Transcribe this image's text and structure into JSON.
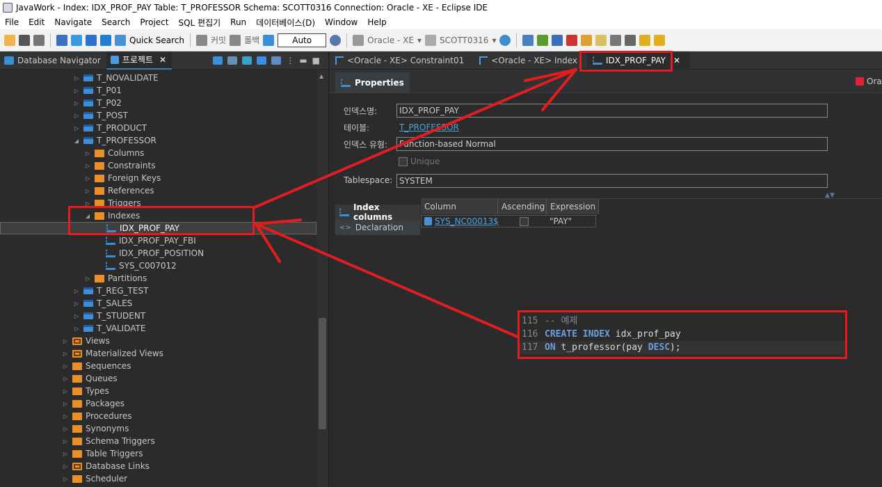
{
  "window": {
    "title": "JavaWork - Index: IDX_PROF_PAY Table: T_PROFESSOR Schema: SCOTT0316 Connection: Oracle - XE  - Eclipse IDE"
  },
  "menu": [
    "File",
    "Edit",
    "Navigate",
    "Search",
    "Project",
    "SQL 편집기",
    "Run",
    "데이터베이스(D)",
    "Window",
    "Help"
  ],
  "toolbar": {
    "quick_search": "Quick Search",
    "commit": "커밋",
    "rollback": "롤백",
    "mode": "Auto",
    "connection": "Oracle - XE",
    "schema": "SCOTT0316"
  },
  "left_panel": {
    "tab_db_navigator": "Database Navigator",
    "tab_project": "프로젝트",
    "tree": [
      {
        "label": "T_NOVALIDATE",
        "icon": "table-icon",
        "expand": "collapsed",
        "indent": 1
      },
      {
        "label": "T_P01",
        "icon": "table-icon",
        "expand": "collapsed",
        "indent": 1
      },
      {
        "label": "T_P02",
        "icon": "table-icon",
        "expand": "collapsed",
        "indent": 1
      },
      {
        "label": "T_POST",
        "icon": "table-icon",
        "expand": "collapsed",
        "indent": 1
      },
      {
        "label": "T_PRODUCT",
        "icon": "table-icon",
        "expand": "collapsed",
        "indent": 1
      },
      {
        "label": "T_PROFESSOR",
        "icon": "table-icon",
        "expand": "expanded",
        "indent": 1
      },
      {
        "label": "Columns",
        "icon": "folder-icon",
        "expand": "collapsed",
        "indent": 2
      },
      {
        "label": "Constraints",
        "icon": "folder-icon",
        "expand": "collapsed",
        "indent": 2
      },
      {
        "label": "Foreign Keys",
        "icon": "folder-icon",
        "expand": "collapsed",
        "indent": 2
      },
      {
        "label": "References",
        "icon": "folder-icon",
        "expand": "collapsed",
        "indent": 2
      },
      {
        "label": "Triggers",
        "icon": "folder-icon",
        "expand": "collapsed",
        "indent": 2
      },
      {
        "label": "Indexes",
        "icon": "folder-icon",
        "expand": "expanded",
        "indent": 2
      },
      {
        "label": "IDX_PROF_PAY",
        "icon": "index-icon",
        "expand": "none",
        "indent": 3,
        "selected": true
      },
      {
        "label": "IDX_PROF_PAY_FBI",
        "icon": "index-icon",
        "expand": "none",
        "indent": 3
      },
      {
        "label": "IDX_PROF_POSITION",
        "icon": "index-icon",
        "expand": "none",
        "indent": 3
      },
      {
        "label": "SYS_C007012",
        "icon": "index-icon",
        "expand": "none",
        "indent": 3
      },
      {
        "label": "Partitions",
        "icon": "folder-icon",
        "expand": "collapsed",
        "indent": 2
      },
      {
        "label": "T_REG_TEST",
        "icon": "table-icon",
        "expand": "collapsed",
        "indent": 1
      },
      {
        "label": "T_SALES",
        "icon": "table-icon",
        "expand": "collapsed",
        "indent": 1
      },
      {
        "label": "T_STUDENT",
        "icon": "table-icon",
        "expand": "collapsed",
        "indent": 1
      },
      {
        "label": "T_VALIDATE",
        "icon": "table-icon",
        "expand": "collapsed",
        "indent": 1
      },
      {
        "label": "Views",
        "icon": "view-folder-icon",
        "expand": "collapsed",
        "indent": 0
      },
      {
        "label": "Materialized Views",
        "icon": "view-folder-icon",
        "expand": "collapsed",
        "indent": 0
      },
      {
        "label": "Sequences",
        "icon": "folder-icon",
        "expand": "collapsed",
        "indent": 0
      },
      {
        "label": "Queues",
        "icon": "folder-icon",
        "expand": "collapsed",
        "indent": 0
      },
      {
        "label": "Types",
        "icon": "folder-icon",
        "expand": "collapsed",
        "indent": 0
      },
      {
        "label": "Packages",
        "icon": "folder-icon",
        "expand": "collapsed",
        "indent": 0
      },
      {
        "label": "Procedures",
        "icon": "folder-icon",
        "expand": "collapsed",
        "indent": 0
      },
      {
        "label": "Synonyms",
        "icon": "folder-icon",
        "expand": "collapsed",
        "indent": 0
      },
      {
        "label": "Schema Triggers",
        "icon": "folder-icon",
        "expand": "collapsed",
        "indent": 0
      },
      {
        "label": "Table Triggers",
        "icon": "folder-icon",
        "expand": "collapsed",
        "indent": 0
      },
      {
        "label": "Database Links",
        "icon": "view-folder-icon",
        "expand": "collapsed",
        "indent": 0
      },
      {
        "label": "Scheduler",
        "icon": "folder-icon",
        "expand": "collapsed",
        "indent": 0
      }
    ]
  },
  "editor_tabs": [
    "<Oracle - XE> Constraint01",
    "<Oracle - XE> Index",
    "IDX_PROF_PAY"
  ],
  "properties": {
    "tab_label": "Properties",
    "ora_label": "Ora",
    "index_name_label": "인덱스명:",
    "index_name_value": "IDX_PROF_PAY",
    "table_label": "테이블:",
    "table_value": "T_PROFESSOR",
    "index_type_label": "인덱스 유형:",
    "index_type_value": "Function-based Normal",
    "unique_label": "Unique",
    "tablespace_label": "Tablespace:",
    "tablespace_value": "SYSTEM",
    "section_index_columns": "Index columns",
    "section_declaration": "Declaration",
    "columns_headers": [
      "Column",
      "Ascending",
      "Expression"
    ],
    "columns_rows": [
      {
        "column": "SYS_NC00013$",
        "ascending": false,
        "expression": "\"PAY\""
      }
    ]
  },
  "code": [
    {
      "line": "115",
      "text": "-- 예제"
    },
    {
      "line": "116",
      "text": "CREATE INDEX idx_prof_pay"
    },
    {
      "line": "117",
      "text": "ON t_professor(pay DESC);"
    }
  ],
  "colors": {
    "annotation": "#e11d1d",
    "accent": "#3b8fd9",
    "folder": "#e8902a"
  }
}
